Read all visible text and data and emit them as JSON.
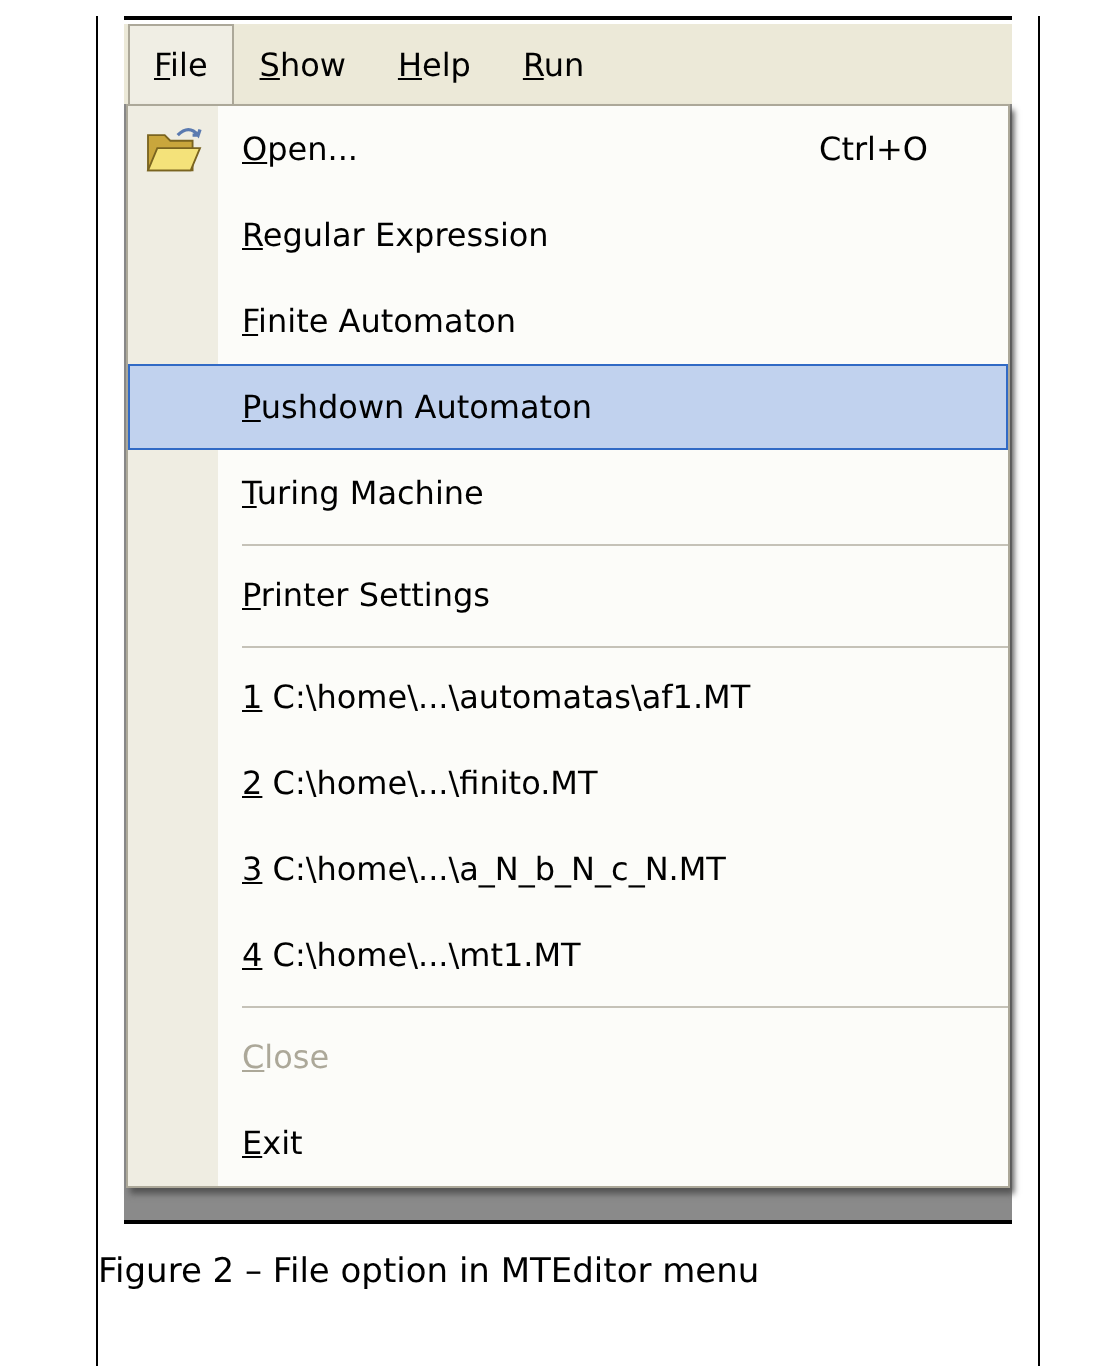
{
  "menubar": [
    {
      "label": "File",
      "selected": true
    },
    {
      "label": "Show",
      "selected": false
    },
    {
      "label": "Help",
      "selected": false
    },
    {
      "label": "Run",
      "selected": false
    }
  ],
  "underline_mnemonics": true,
  "menu": [
    {
      "kind": "icon-item",
      "label": "Open...",
      "shortcut": "Ctrl+O",
      "selected": false,
      "disabled": false
    },
    {
      "kind": "item",
      "label": "Regular Expression",
      "selected": false,
      "disabled": false
    },
    {
      "kind": "item",
      "label": "Finite Automaton",
      "selected": false,
      "disabled": false
    },
    {
      "kind": "item",
      "label": "Pushdown Automaton",
      "selected": true,
      "disabled": false
    },
    {
      "kind": "item",
      "label": "Turing Machine",
      "selected": false,
      "disabled": false
    },
    {
      "kind": "separator"
    },
    {
      "kind": "item",
      "label": "Printer Settings",
      "selected": false,
      "disabled": false
    },
    {
      "kind": "separator"
    },
    {
      "kind": "item",
      "label": "1 C:\\home\\...\\automatas\\af1.MT",
      "selected": false,
      "disabled": false
    },
    {
      "kind": "item",
      "label": "2 C:\\home\\...\\finito.MT",
      "selected": false,
      "disabled": false
    },
    {
      "kind": "item",
      "label": "3 C:\\home\\...\\a_N_b_N_c_N.MT",
      "selected": false,
      "disabled": false
    },
    {
      "kind": "item",
      "label": "4 C:\\home\\...\\mt1.MT",
      "selected": false,
      "disabled": false
    },
    {
      "kind": "separator"
    },
    {
      "kind": "item",
      "label": "Close",
      "selected": false,
      "disabled": true
    },
    {
      "kind": "item",
      "label": "Exit",
      "selected": false,
      "disabled": false
    }
  ],
  "caption": "Figure 2 – File option in MTEditor menu"
}
